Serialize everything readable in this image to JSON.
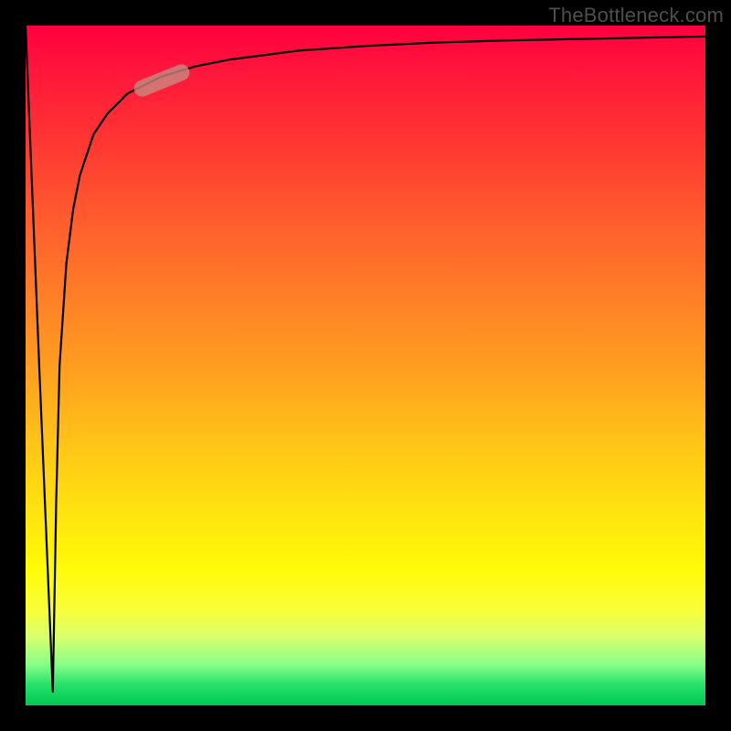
{
  "watermark": "TheBottleneck.com",
  "colors": {
    "frame": "#000000",
    "curve": "#000000",
    "marker": "#c88c82",
    "gradient_top": "#ff0040",
    "gradient_bottom": "#00c853"
  },
  "chart_data": {
    "type": "line",
    "title": "",
    "xlabel": "",
    "ylabel": "",
    "xlim": [
      0,
      100
    ],
    "ylim": [
      0,
      100
    ],
    "grid": false,
    "legend": false,
    "annotations": [
      {
        "text": "TheBottleneck.com",
        "position": "top-right"
      }
    ],
    "series": [
      {
        "name": "curve",
        "description": "sharp dip to bottom at x≈4 then logarithmic rise toward top-right",
        "x": [
          0,
          2,
          4,
          4.5,
          5,
          6,
          7,
          8,
          10,
          12,
          15,
          20,
          25,
          30,
          40,
          50,
          60,
          70,
          80,
          90,
          100
        ],
        "y": [
          100,
          50,
          2,
          30,
          50,
          65,
          73,
          78,
          84,
          87,
          90,
          92.5,
          94,
          95,
          96.3,
          97,
          97.5,
          97.8,
          98,
          98.2,
          98.4
        ]
      }
    ],
    "marker": {
      "x": 20,
      "y": 92,
      "angle_deg": -22
    },
    "background_gradient": {
      "direction": "vertical",
      "stops": [
        {
          "pct": 0,
          "color": "#ff0040"
        },
        {
          "pct": 40,
          "color": "#ff7f27"
        },
        {
          "pct": 80,
          "color": "#fffb07"
        },
        {
          "pct": 100,
          "color": "#00c853"
        }
      ]
    }
  }
}
